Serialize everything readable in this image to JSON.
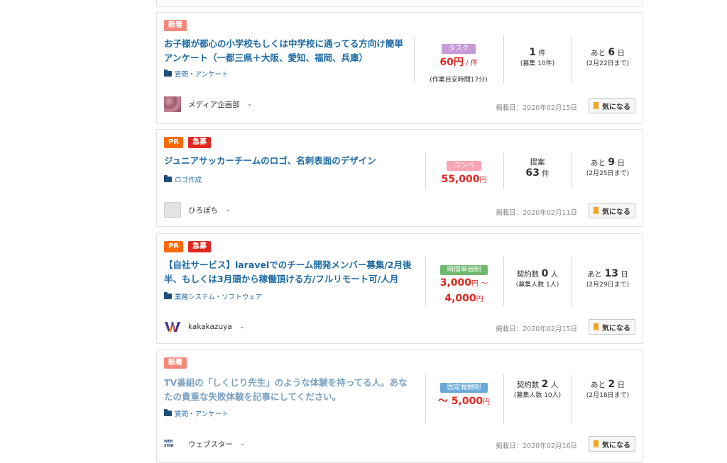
{
  "jobs": [
    {
      "badges": [
        "新着"
      ],
      "title": "お子様が都心の小学校もしくは中学校に通ってる方向け簡単アンケート（一都三県＋大阪、愛知、福岡、兵庫）",
      "category": "質問・アンケート",
      "type_tag": "タスク",
      "price_main": "60円",
      "price_suffix": " / 件",
      "price_note": "(作業目安時間17分)",
      "count_main": "1",
      "count_unit": " 件",
      "count_sub": "(募集 10件)",
      "deadline_prefix": "あと ",
      "deadline_num": "6",
      "deadline_unit": " 日",
      "deadline_sub": "(2月22日まで)",
      "client": "メディア企画部",
      "posted": "掲載日：2020年02月15日",
      "fav_label": "気になる"
    },
    {
      "badges": [
        "PR",
        "急募"
      ],
      "title": "ジュニアサッカーチームのロゴ、名刺表面のデザイン",
      "category": "ロゴ作成",
      "type_tag": "コンペ",
      "price_main": "55,000",
      "price_suffix": "円",
      "count_label": "提案",
      "count_main": "63",
      "count_unit": " 件",
      "deadline_prefix": "あと ",
      "deadline_num": "9",
      "deadline_unit": " 日",
      "deadline_sub": "(2月25日まで)",
      "client": "ひろぽち",
      "posted": "掲載日：2020年02月11日",
      "fav_label": "気になる"
    },
    {
      "badges": [
        "PR",
        "急募"
      ],
      "title": "【自社サービス】laravelでのチーム開発メンバー募集/2月後半、もしくは3月頭から稼働頂ける方/フルリモート可/人月単…",
      "category": "業務システム・ソフトウェア",
      "type_tag": "時間単価制",
      "price_line1": "3,000",
      "price_line1_suffix": "円 〜",
      "price_line2": "4,000",
      "price_line2_suffix": "円",
      "count_prefix": "契約数 ",
      "count_main": "0",
      "count_unit": " 人",
      "count_sub": "(募集人数 1人)",
      "deadline_prefix": "あと ",
      "deadline_num": "13",
      "deadline_unit": " 日",
      "deadline_sub": "(2月29日まで)",
      "client": "kakakazuya",
      "posted": "掲載日：2020年02月15日",
      "fav_label": "気になる"
    },
    {
      "badges": [
        "新着"
      ],
      "title": "TV番組の「しくじり先生」のような体験を持ってる人。あなたの貴重な失敗体験を記事にしてください。",
      "category": "質問・アンケート",
      "type_tag": "固定報酬制",
      "price_prefix": "〜 ",
      "price_main": "5,000",
      "price_suffix": "円",
      "count_prefix": "契約数 ",
      "count_main": "2",
      "count_unit": " 人",
      "count_sub": "(募集人数 10人)",
      "deadline_prefix": "あと ",
      "deadline_num": "2",
      "deadline_unit": " 日",
      "deadline_sub": "(2月18日まで)",
      "client": "ウェブスター",
      "client_logo_text": "WEB STAR",
      "posted": "掲載日：2020年02月16日",
      "fav_label": "気になる"
    }
  ],
  "colors": {
    "link": "#1d6aa5",
    "visited_link": "#7ba2c2",
    "price_red": "#e0271f",
    "badge_new": "#f58a7a",
    "badge_pr": "#ff6a00",
    "badge_urgent": "#e0271f",
    "tag_task": "#c79ad8",
    "tag_compe": "#f7a6b4",
    "tag_hourly": "#6fb96f",
    "tag_fixed": "#6aa9d8",
    "bookmark": "#f3a21b"
  }
}
